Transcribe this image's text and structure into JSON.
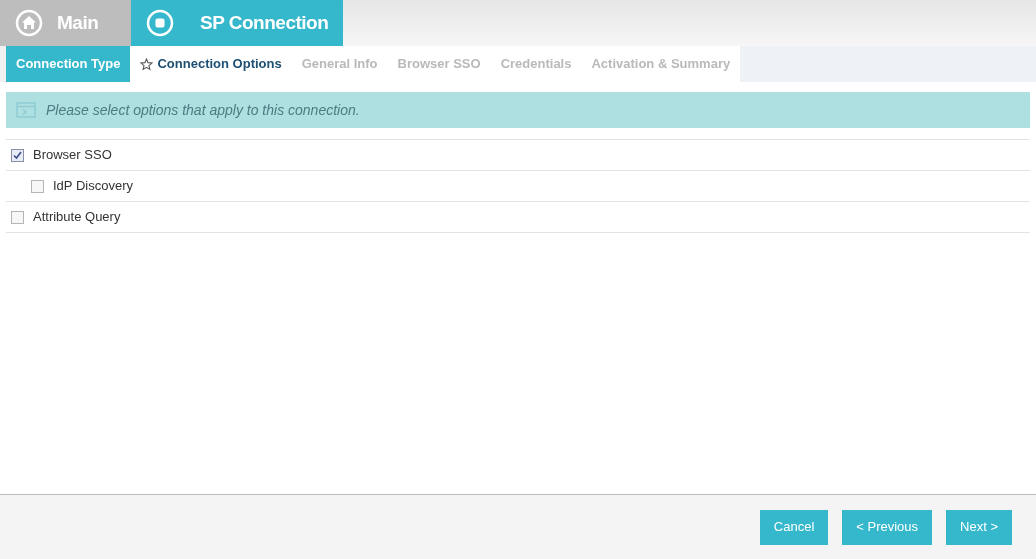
{
  "header_tabs": [
    {
      "label": "Main",
      "selected": false
    },
    {
      "label": "SP Connection",
      "selected": true
    }
  ],
  "wizard_tabs": [
    {
      "label": "Connection Type",
      "selected": false,
      "completed": true,
      "disabled": false
    },
    {
      "label": "Connection Options",
      "selected": true,
      "completed": false,
      "disabled": false
    },
    {
      "label": "General Info",
      "selected": false,
      "completed": false,
      "disabled": true
    },
    {
      "label": "Browser SSO",
      "selected": false,
      "completed": false,
      "disabled": true
    },
    {
      "label": "Credentials",
      "selected": false,
      "completed": false,
      "disabled": true
    },
    {
      "label": "Activation & Summary",
      "selected": false,
      "completed": false,
      "disabled": true
    }
  ],
  "banner": {
    "text": "Please select options that apply to this connection."
  },
  "options": [
    {
      "label": "Browser SSO",
      "checked": true,
      "children": [
        {
          "label": "IdP Discovery",
          "checked": false
        }
      ]
    },
    {
      "label": "Attribute Query",
      "checked": false
    }
  ],
  "buttons": [
    "Cancel",
    "< Previous",
    "Next >"
  ]
}
